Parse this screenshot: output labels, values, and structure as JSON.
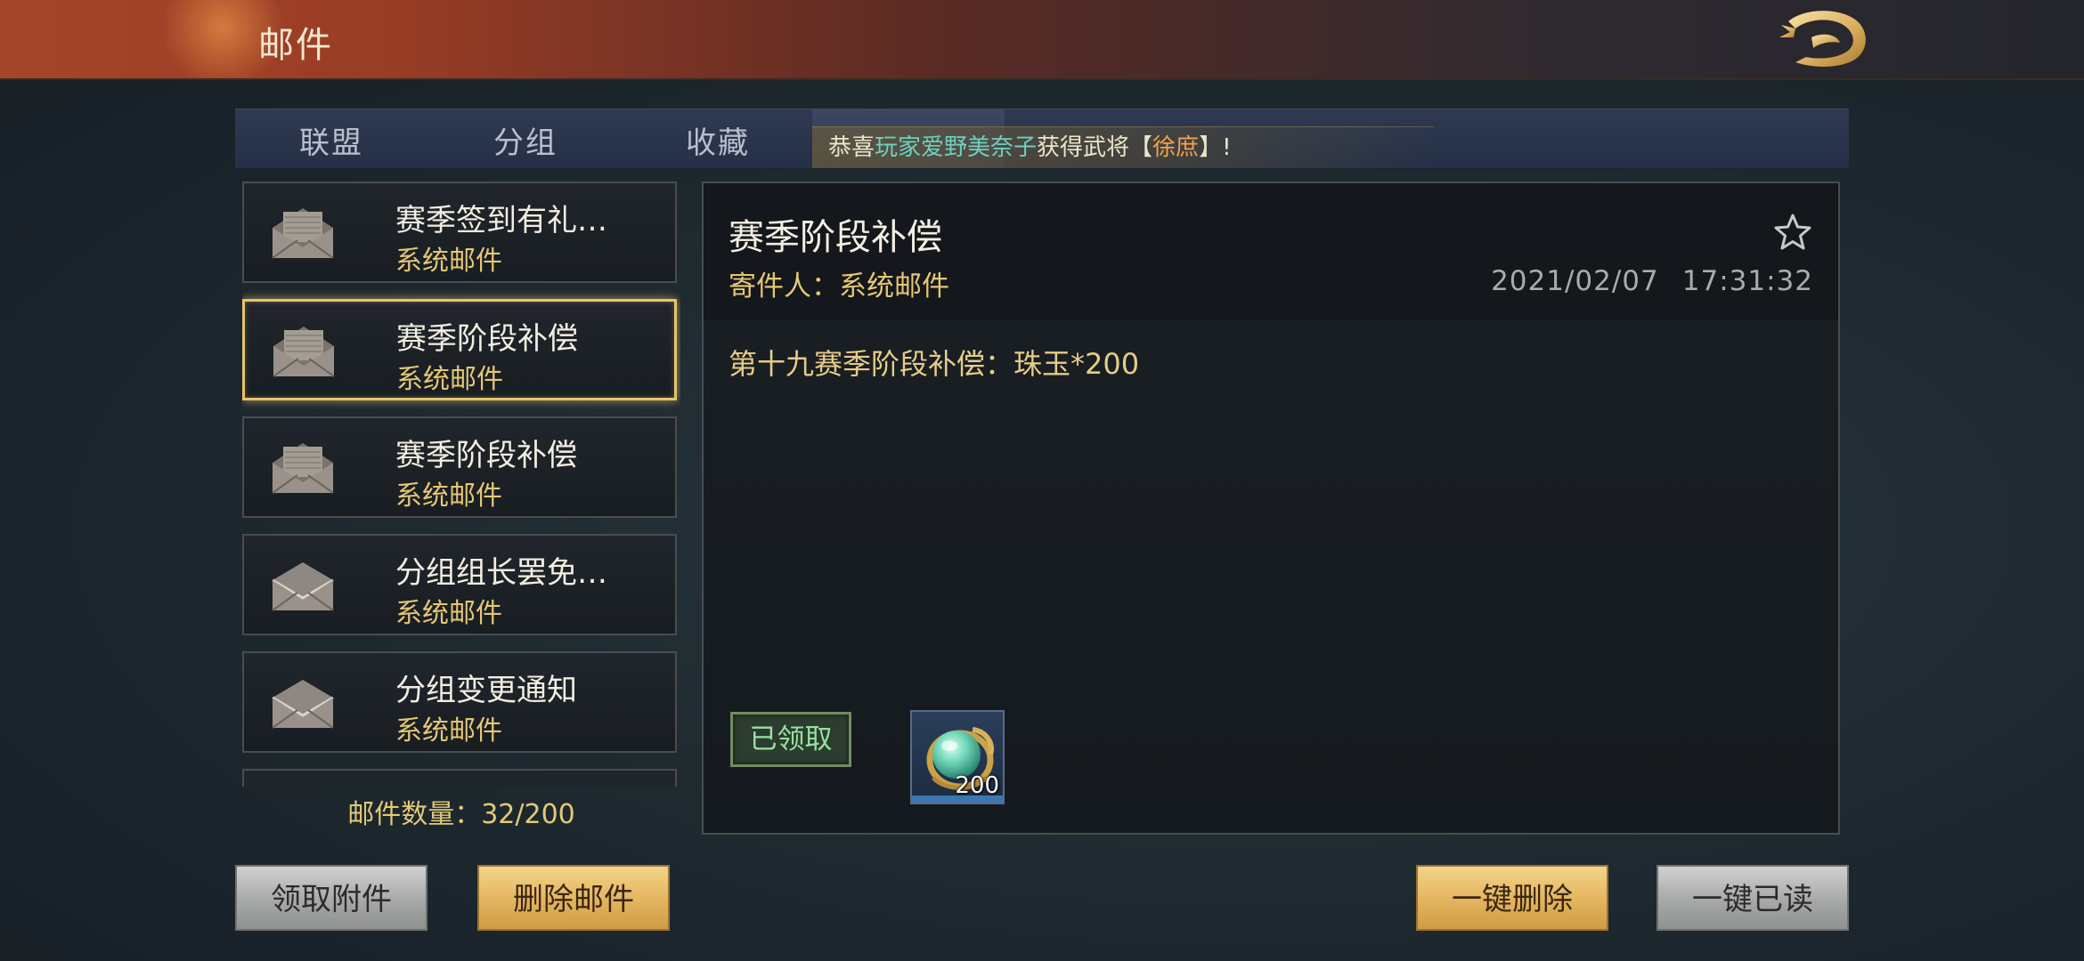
{
  "header": {
    "title": "邮件",
    "logo_icon": "dragon-logo-icon"
  },
  "tabs": [
    "联盟",
    "分组",
    "收藏"
  ],
  "marquee": {
    "prefix": "恭喜",
    "player": "玩家爱野美奈子",
    "middle": "获得武将【",
    "general": "徐庶",
    "suffix": "】!"
  },
  "mail_list": [
    {
      "subject": "赛季签到有礼…",
      "sender": "系统邮件",
      "icon": "envelope-open-icon",
      "selected": false
    },
    {
      "subject": "赛季阶段补偿",
      "sender": "系统邮件",
      "icon": "envelope-open-icon",
      "selected": true
    },
    {
      "subject": "赛季阶段补偿",
      "sender": "系统邮件",
      "icon": "envelope-open-icon",
      "selected": false
    },
    {
      "subject": "分组组长罢免…",
      "sender": "系统邮件",
      "icon": "envelope-read-icon",
      "selected": false
    },
    {
      "subject": "分组变更通知",
      "sender": "系统邮件",
      "icon": "envelope-read-icon",
      "selected": false
    }
  ],
  "mail_count": "邮件数量：32/200",
  "detail": {
    "title": "赛季阶段补偿",
    "sender": "寄件人：系统邮件",
    "date": "2021/02/07",
    "time": "17:31:32",
    "body": "第十九赛季阶段补偿：珠玉*200",
    "status": "已领取",
    "reward": {
      "icon": "jade-orb-icon",
      "quantity": "200"
    }
  },
  "buttons": {
    "claim": "领取附件",
    "delete": "删除邮件",
    "delete_all": "一键删除",
    "read_all": "一键已读"
  },
  "colors": {
    "accent_gold": "#e6c46a",
    "sender_gold": "#e5c775",
    "claimed_green": "#98e0a0"
  }
}
